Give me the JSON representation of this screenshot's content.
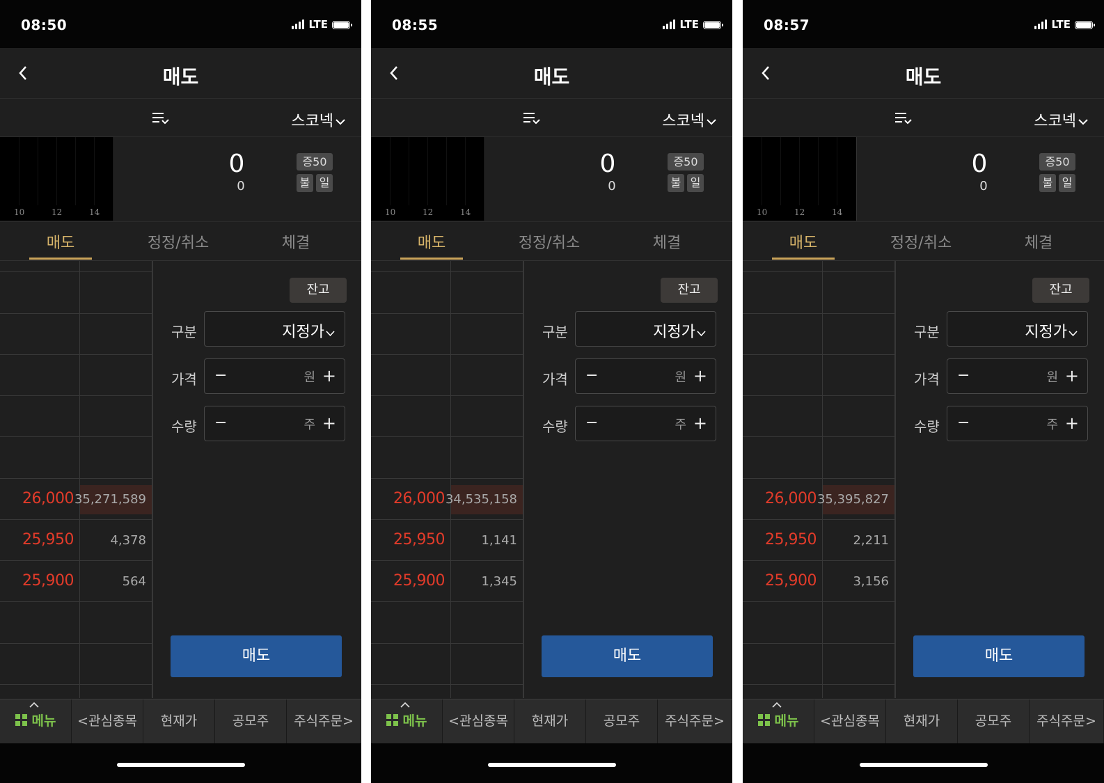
{
  "common": {
    "title": "매도",
    "stock_name": "스코넥",
    "current_price": "0",
    "change": "0",
    "badge_margin": "증50",
    "badge_1": "불",
    "badge_2": "일",
    "chart_ticks": [
      "10",
      "12",
      "14"
    ],
    "network": "LTE",
    "tabs": [
      "매도",
      "정정/취소",
      "체결"
    ],
    "balance_label": "잔고",
    "type_label": "구분",
    "type_value": "지정가",
    "price_label": "가격",
    "price_unit": "원",
    "qty_label": "수량",
    "qty_unit": "주",
    "minus": "−",
    "plus": "+",
    "sell_button": "매도",
    "nav": [
      "메뉴",
      "관심종목",
      "현재가",
      "공모주",
      "주식주문"
    ],
    "nav_prev": "<",
    "nav_next": ">"
  },
  "screens": [
    {
      "time": "08:50",
      "book": [
        {
          "price": "26,000",
          "qty": "35,271,589"
        },
        {
          "price": "25,950",
          "qty": "4,378"
        },
        {
          "price": "25,900",
          "qty": "564"
        }
      ]
    },
    {
      "time": "08:55",
      "book": [
        {
          "price": "26,000",
          "qty": "34,535,158"
        },
        {
          "price": "25,950",
          "qty": "1,141"
        },
        {
          "price": "25,900",
          "qty": "1,345"
        }
      ]
    },
    {
      "time": "08:57",
      "book": [
        {
          "price": "26,000",
          "qty": "35,395,827"
        },
        {
          "price": "25,950",
          "qty": "2,211"
        },
        {
          "price": "25,900",
          "qty": "3,156"
        }
      ]
    }
  ]
}
